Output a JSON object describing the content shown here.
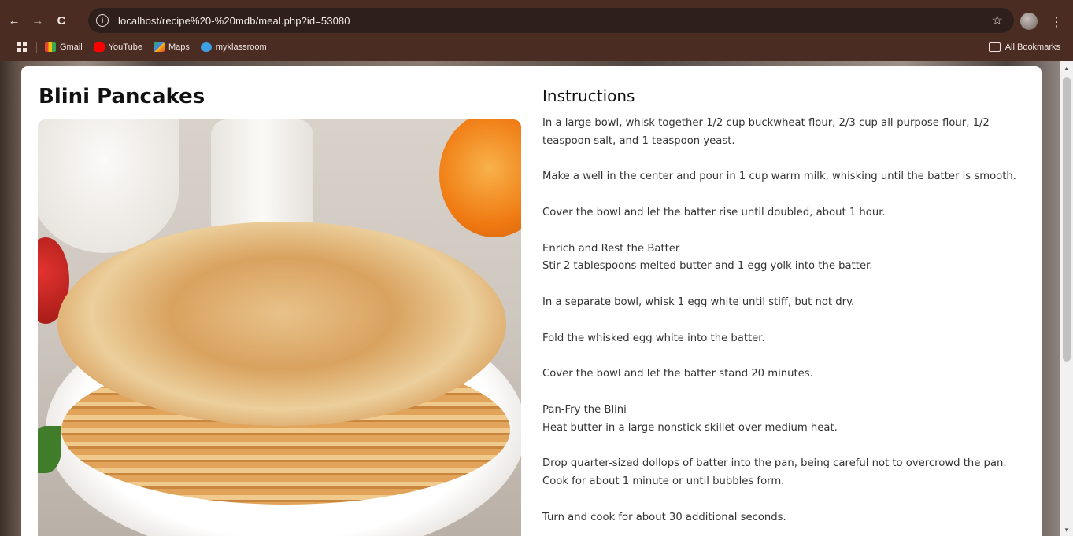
{
  "browser": {
    "url": "localhost/recipe%20-%20mdb/meal.php?id=53080",
    "nav": {
      "back": "←",
      "forward": "→",
      "reload": "C"
    },
    "star": "☆",
    "menu": "⋮",
    "bookmarks": [
      {
        "label": "Gmail",
        "icon": "gmail-icon"
      },
      {
        "label": "YouTube",
        "icon": "youtube-icon"
      },
      {
        "label": "Maps",
        "icon": "maps-icon"
      },
      {
        "label": "myklassroom",
        "icon": "myklassroom-icon"
      }
    ],
    "all_bookmarks": "All Bookmarks"
  },
  "recipe": {
    "title": "Blini Pancakes",
    "instructions_heading": "Instructions",
    "steps": [
      "In a large bowl, whisk together 1/2 cup buckwheat flour, 2/3 cup all-purpose flour, 1/2 teaspoon salt, and 1 teaspoon yeast.",
      "Make a well in the center and pour in 1 cup warm milk, whisking until the batter is smooth.",
      "Cover the bowl and let the batter rise until doubled, about 1 hour.",
      "Enrich and Rest the Batter\nStir 2 tablespoons melted butter and 1 egg yolk into the batter.",
      "In a separate bowl, whisk 1 egg white until stiff, but not dry.",
      "Fold the whisked egg white into the batter.",
      "Cover the bowl and let the batter stand 20 minutes.",
      "Pan-Fry the Blini\nHeat butter in a large nonstick skillet over medium heat.",
      "Drop quarter-sized dollops of batter into the pan, being careful not to overcrowd the pan. Cook for about 1 minute or until bubbles form.",
      "Turn and cook for about 30 additional seconds."
    ]
  }
}
